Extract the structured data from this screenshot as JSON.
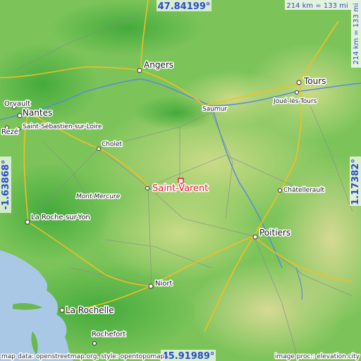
{
  "map": {
    "coordinates": {
      "top_latitude": "47.84199°",
      "bottom_latitude": "45.91989°",
      "left_longitude": "-1.63868°",
      "right_longitude": "1.17382°"
    },
    "scale": {
      "horizontal": "214 km = 133 mi",
      "vertical": "214 km = 133 mi"
    },
    "marker": {
      "label": "Saint-Varent",
      "color": "#e0202a"
    },
    "places": [
      "Angers",
      "Tours",
      "Saumur",
      "Joué-lès-Tours",
      "Orvault",
      "Nantes",
      "Rezé",
      "Saint-Sébastien-sur-Loire",
      "Cholet",
      "Mont Mercure",
      "Châtellerault",
      "La Roche-sur-Yon",
      "Poitiers",
      "Niort",
      "La Rochelle",
      "Rochefort"
    ],
    "credits": {
      "left": "map data: openstreetmap.org, style: opentopomap",
      "right": "image proc.: elevation.city"
    },
    "colors": {
      "sea": "#a8c8e6",
      "lowland": "#7cc45a",
      "upland": "#b8d878",
      "highland": "#d8d890",
      "road": "#f0c020",
      "river": "#5a8ad8",
      "coord_text": "#2a4ec8"
    }
  }
}
